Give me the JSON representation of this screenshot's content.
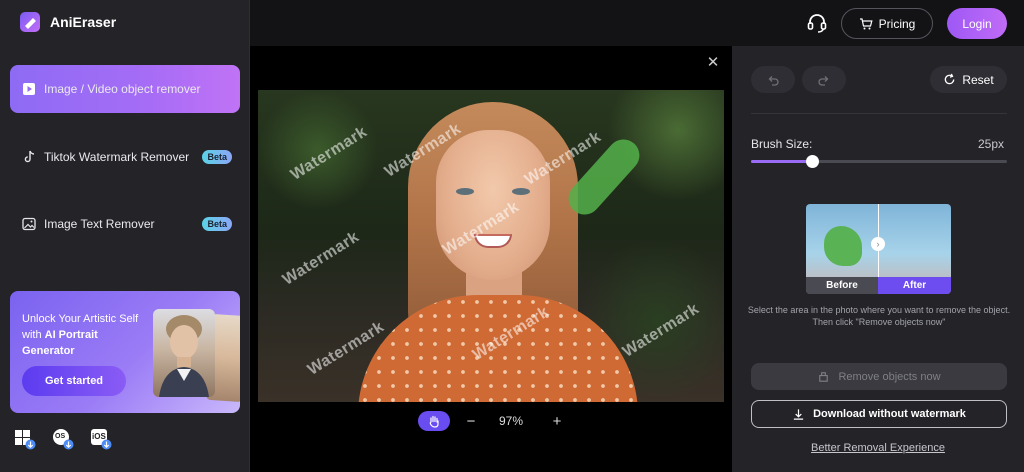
{
  "app": {
    "name": "AniEraser",
    "brand_gradient": [
      "#8e6bf4",
      "#c073f5"
    ]
  },
  "sidebar": {
    "items": [
      {
        "label": "Image / Video object remover",
        "icon": "play-square-icon",
        "active": true,
        "badge": ""
      },
      {
        "label": "Tiktok Watermark Remover",
        "icon": "tiktok-icon",
        "active": false,
        "badge": "Beta"
      },
      {
        "label": "Image Text Remover",
        "icon": "image-icon",
        "active": false,
        "badge": "Beta"
      }
    ],
    "promo": {
      "text_prefix": "Unlock Your Artistic Self with ",
      "text_bold": "AI Portrait Generator",
      "button": "Get started"
    },
    "platforms": [
      {
        "name": "windows-download-icon",
        "label": ""
      },
      {
        "name": "macos-download-icon",
        "label": "OS"
      },
      {
        "name": "ios-download-icon",
        "label": "iOS"
      }
    ]
  },
  "header": {
    "pricing_label": "Pricing",
    "login_label": "Login",
    "support_icon": "headset-icon"
  },
  "canvas": {
    "close_icon": "close-icon",
    "watermark_text": "Watermark",
    "zoom": "97%",
    "zoom_out": "−",
    "zoom_in": "+"
  },
  "panel": {
    "reset_label": "Reset",
    "brush_label": "Brush Size:",
    "brush_value": "25px",
    "brush_fraction": 0.24,
    "compare": {
      "before": "Before",
      "after": "After"
    },
    "hint": "Select the area in the photo where you want to remove the object. Then click \"Remove objects now\"",
    "remove_label": "Remove objects now",
    "download_label": "Download without watermark",
    "better_link": "Better Removal Experience"
  }
}
